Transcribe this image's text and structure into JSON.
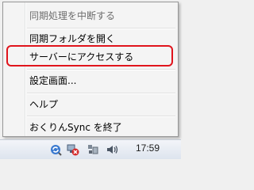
{
  "menu": {
    "items": [
      {
        "label": "同期処理を中断する",
        "disabled": true
      },
      {
        "label": "同期フォルダを開く",
        "disabled": false
      },
      {
        "label": "サーバーにアクセスする",
        "disabled": false
      },
      {
        "label": "設定画面...",
        "disabled": false
      },
      {
        "label": "ヘルプ",
        "disabled": false
      },
      {
        "label": "おくりんSync を終了",
        "disabled": false
      }
    ],
    "highlighted_item": "サーバーにアクセスする"
  },
  "taskbar": {
    "clock": "17:59",
    "tray_icons": [
      "sync-app-icon",
      "network-error-icon",
      "display-icon",
      "volume-icon"
    ]
  },
  "colors": {
    "highlight_border": "#e0141c",
    "menu_background": "#f4f4f4"
  }
}
